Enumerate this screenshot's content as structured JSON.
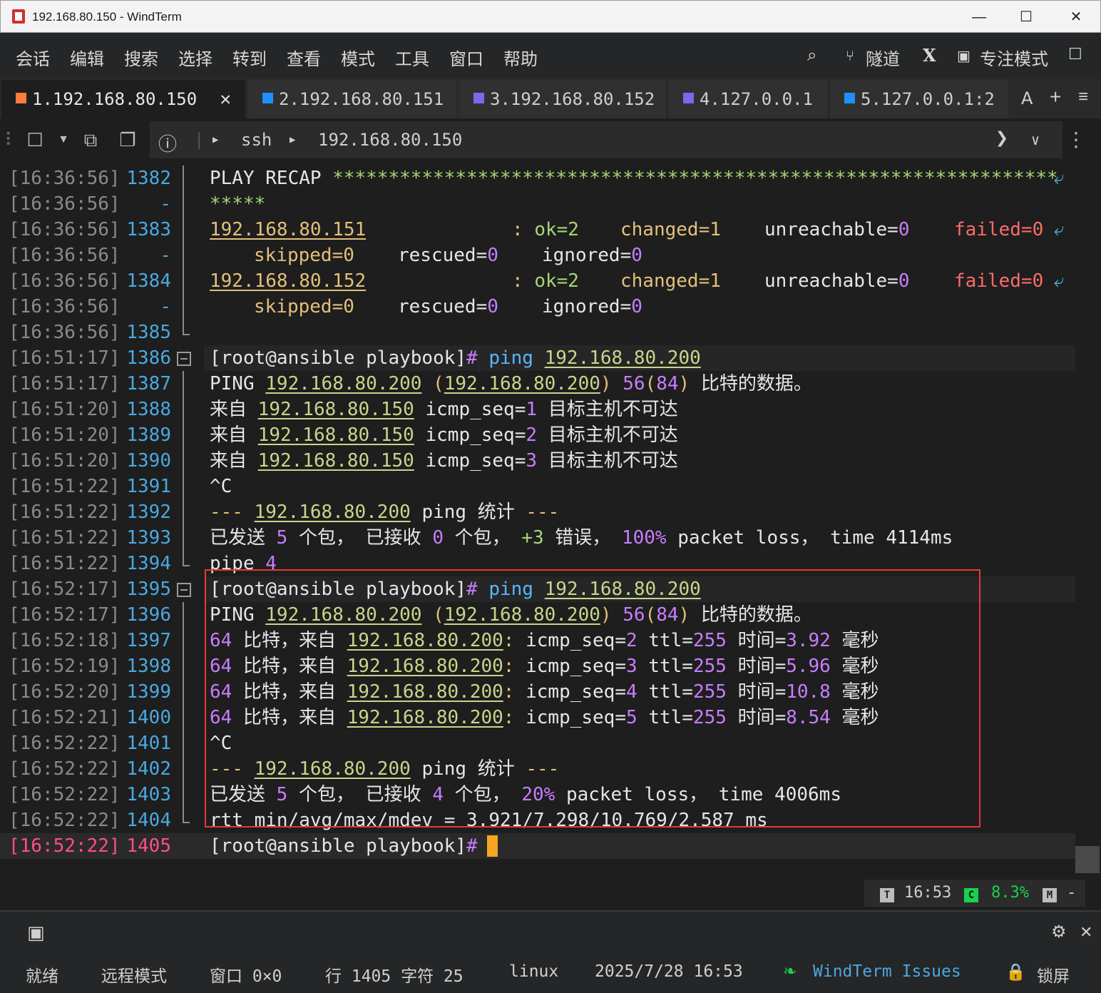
{
  "window": {
    "title": "192.168.80.150 - WindTerm",
    "minimize": "—",
    "maximize": "☐",
    "close": "✕"
  },
  "menu": {
    "items": [
      "会话",
      "编辑",
      "搜索",
      "选择",
      "转到",
      "查看",
      "模式",
      "工具",
      "窗口",
      "帮助"
    ],
    "tunnel": "隧道",
    "focus_mode": "专注模式",
    "x_label": "X"
  },
  "tabs": [
    {
      "label": "1.192.168.80.150",
      "color": "#ff7a3d",
      "active": true
    },
    {
      "label": "2.192.168.80.151",
      "color": "#1e90ff",
      "active": false
    },
    {
      "label": "3.192.168.80.152",
      "color": "#7b68ee",
      "active": false
    },
    {
      "label": "4.127.0.0.1",
      "color": "#7b68ee",
      "active": false
    },
    {
      "label": "5.127.0.0.1:2",
      "color": "#1e90ff",
      "active": false
    }
  ],
  "tabbar_right": {
    "a_label": "A",
    "plus": "+",
    "menu": "≡"
  },
  "toolbar": {
    "protocol": "ssh",
    "host": "192.168.80.150"
  },
  "terminal": {
    "lines": [
      {
        "ts": "[16:36:56]",
        "ln": "1382"
      },
      {
        "ts": "[16:36:56]",
        "ln": "-"
      },
      {
        "ts": "[16:36:56]",
        "ln": "1383"
      },
      {
        "ts": "[16:36:56]",
        "ln": "-"
      },
      {
        "ts": "[16:36:56]",
        "ln": "1384"
      },
      {
        "ts": "[16:36:56]",
        "ln": "-"
      },
      {
        "ts": "[16:36:56]",
        "ln": "1385"
      },
      {
        "ts": "[16:51:17]",
        "ln": "1386"
      },
      {
        "ts": "[16:51:17]",
        "ln": "1387"
      },
      {
        "ts": "[16:51:20]",
        "ln": "1388"
      },
      {
        "ts": "[16:51:20]",
        "ln": "1389"
      },
      {
        "ts": "[16:51:20]",
        "ln": "1390"
      },
      {
        "ts": "[16:51:22]",
        "ln": "1391"
      },
      {
        "ts": "[16:51:22]",
        "ln": "1392"
      },
      {
        "ts": "[16:51:22]",
        "ln": "1393"
      },
      {
        "ts": "[16:51:22]",
        "ln": "1394"
      },
      {
        "ts": "[16:52:17]",
        "ln": "1395"
      },
      {
        "ts": "[16:52:17]",
        "ln": "1396"
      },
      {
        "ts": "[16:52:18]",
        "ln": "1397"
      },
      {
        "ts": "[16:52:19]",
        "ln": "1398"
      },
      {
        "ts": "[16:52:20]",
        "ln": "1399"
      },
      {
        "ts": "[16:52:21]",
        "ln": "1400"
      },
      {
        "ts": "[16:52:22]",
        "ln": "1401"
      },
      {
        "ts": "[16:52:22]",
        "ln": "1402"
      },
      {
        "ts": "[16:52:22]",
        "ln": "1403"
      },
      {
        "ts": "[16:52:22]",
        "ln": "1404"
      },
      {
        "ts": "[16:52:22]",
        "ln": "1405"
      }
    ],
    "text": {
      "l1382_a": "PLAY RECAP ",
      "l1382_stars": "*****************************************************************",
      "l1382_cont": "*****",
      "host151": "192.168.80.151",
      "host152": "192.168.80.152",
      "colon": ":",
      "ok": "ok=2",
      "changed": "changed=1",
      "unreachable_k": "unreachable=",
      "unreachable_v": "0",
      "failed": "failed=0",
      "skipped": "skipped=0",
      "rescued_k": "rescued=",
      "rescued_v": "0",
      "ignored_k": "ignored=",
      "ignored_v": "0",
      "prompt": "[root@ansible playbook]",
      "hash": "#",
      "ping_cmd": "ping",
      "target": "192.168.80.200",
      "PING": "PING",
      "paren_open": "(",
      "paren_close": ")",
      "size": "56",
      "size2": "84",
      "bytes_of_data": "比特的数据。",
      "from": "来自",
      "src150": "192.168.80.150",
      "icmp_seq": "icmp_seq=",
      "unreachable_msg": "目标主机不可达",
      "ctrlc": "^C",
      "dashes": "---",
      "ping_stats": "ping 统计",
      "sent_label": "已发送",
      "sent": "5",
      "packets": "个包，",
      "recv_label": "已接收",
      "recv1": "0",
      "packets2": "个包，",
      "errors": "+3",
      "errors_label": "错误，",
      "loss1": "100%",
      "loss_label": "packet loss，",
      "time1": "time 4114ms",
      "pipe": "pipe",
      "pipe_n": "4",
      "bytes64": "64",
      "bytes_from": "比特，来自",
      "ttl": "ttl=",
      "ttl_v": "255",
      "time_label": "时间=",
      "ms_label": "毫秒",
      "seqs": [
        "2",
        "3",
        "4",
        "5"
      ],
      "times": [
        "3.92",
        "5.96",
        "10.8",
        "8.54"
      ],
      "recv2": "4",
      "loss2": "20%",
      "time2": "time 4006ms",
      "rtt": "rtt min/avg/max/mdev = 3.921/7.298/10.769/2.587 ms"
    }
  },
  "status_pill": {
    "t": "T",
    "clock": "16:53",
    "c": "C",
    "cpu": "8.3%",
    "m": "M",
    "mem": "-"
  },
  "statusbar": {
    "ready": "就绪",
    "remote_mode": "远程模式",
    "window": "窗口 0×0",
    "position": "行 1405 字符 25",
    "os": "linux",
    "datetime": "2025/7/28 16:53",
    "issues": "WindTerm Issues",
    "lock": "锁屏"
  },
  "colors": {
    "accent_active_tab": "#ff7a3d",
    "line_number": "#4aa8e0",
    "active_line": "#ff4d8d",
    "highlight_box": "#e53935",
    "cursor": "#f5a623"
  }
}
